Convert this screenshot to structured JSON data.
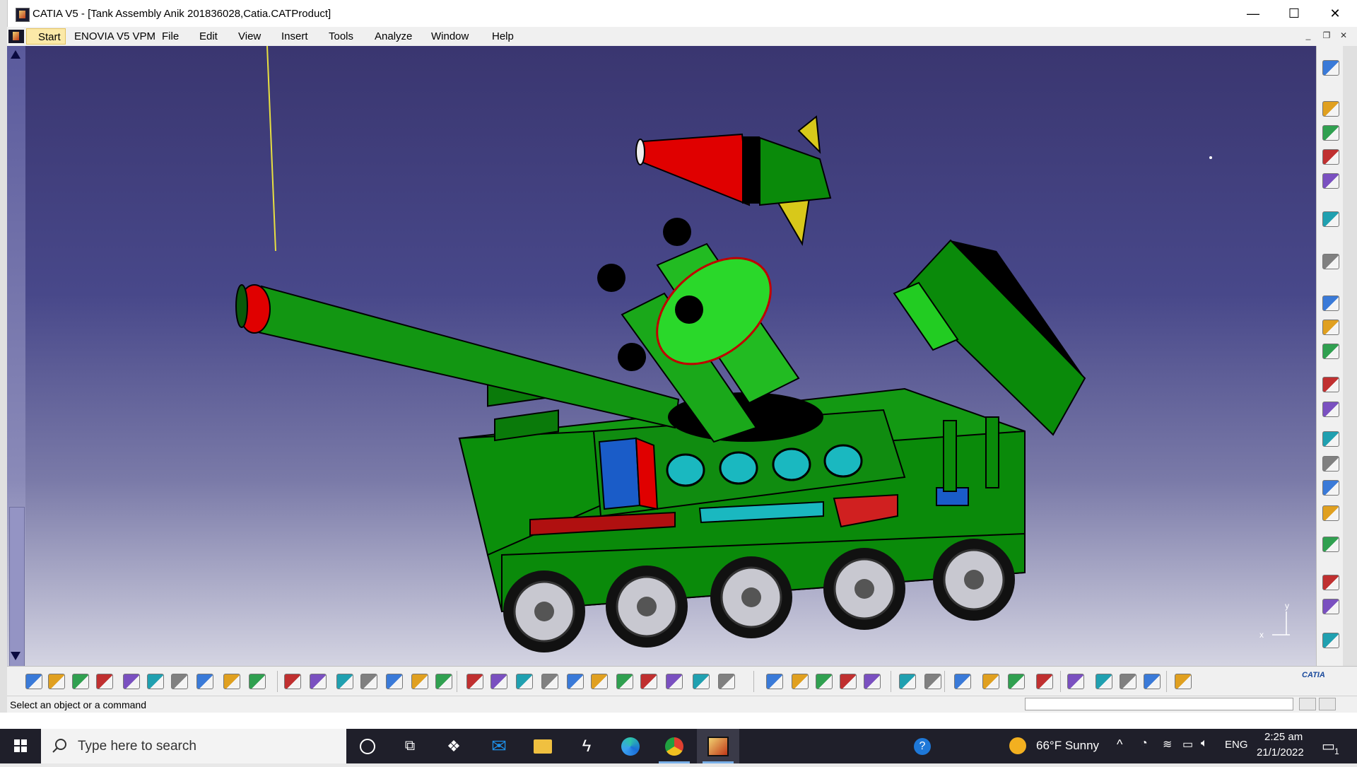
{
  "window": {
    "title": "CATIA V5 - [Tank Assembly Anik 201836028,Catia.CATProduct]",
    "minimize_glyph": "—",
    "maximize_glyph": "☐",
    "close_glyph": "✕"
  },
  "menu": {
    "start": "Start",
    "items": [
      "ENOVIA V5 VPM",
      "File",
      "Edit",
      "View",
      "Insert",
      "Tools",
      "Analyze",
      "Window",
      "Help"
    ]
  },
  "viewport": {
    "compass_x": "x",
    "compass_y": "y",
    "colors": {
      "tank_green": "#0a8a0a",
      "bright_green": "#22cc22",
      "red": "#e00000",
      "black": "#000000",
      "cyan": "#1ab8c0",
      "blue": "#1a5cc8",
      "yellow": "#d8c81a"
    }
  },
  "right_toolbar": {
    "icons": [
      "compass-icon",
      "product-structure-icon",
      "product-structure-icon",
      "product-structure-icon",
      "product-structure-icon",
      "select-arrow-icon",
      "move-icon",
      "constraint-icon",
      "constraint-icon",
      "constraint-icon",
      "insert-icon",
      "insert-icon",
      "update-icon",
      "update-icon",
      "catalog-icon",
      "catalog-icon",
      "catalog-icon",
      "assembly-icon",
      "assembly-icon",
      "assembly-icon"
    ]
  },
  "bottom_toolbar": {
    "icons": [
      "new-icon",
      "open-icon",
      "save-icon",
      "print-icon",
      "cut-icon",
      "copy-icon",
      "paste-icon",
      "undo-icon",
      "redo-icon",
      "whats-this-icon",
      "formula-icon",
      "knowledge-icon",
      "light-icon",
      "table-icon",
      "graph-icon",
      "catalog-icon",
      "plugin-icon",
      "fly-icon",
      "fit-all-icon",
      "pan-icon",
      "rotate-icon",
      "zoom-in-icon",
      "zoom-out-icon",
      "normal-view-icon",
      "multi-view-icon",
      "iso-view-icon",
      "shading-icon",
      "hide-show-icon",
      "swap-icon",
      "compare-icon",
      "skip-icon",
      "catalog-browser-icon",
      "catalog-browser-icon",
      "camera-icon",
      "update-all-icon",
      "measure-icon",
      "analysis-icon",
      "analysis-icon",
      "refresh-icon",
      "plane-icon",
      "render-icon",
      "render-icon",
      "color-icon",
      "grid-icon",
      "catia-logo"
    ],
    "catia_logo_text": "CATIA"
  },
  "status": {
    "message": "Select an object or a command",
    "command_input": ""
  },
  "taskbar": {
    "search_placeholder": "Type here to search",
    "weather": "66°F  Sunny",
    "language": "ENG",
    "time": "2:25 am",
    "date": "21/1/2022",
    "notification_count": "1"
  }
}
